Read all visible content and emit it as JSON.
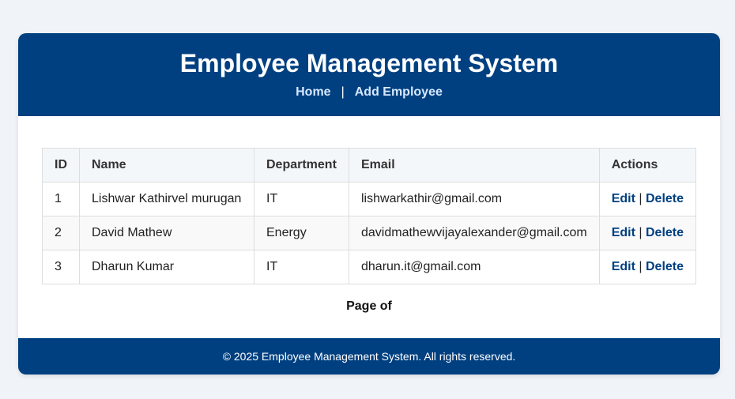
{
  "header": {
    "title": "Employee Management System",
    "nav": {
      "home": "Home",
      "separator": "|",
      "add": "Add Employee"
    }
  },
  "table": {
    "columns": [
      "ID",
      "Name",
      "Department",
      "Email",
      "Actions"
    ],
    "rows": [
      {
        "id": "1",
        "name": "Lishwar Kathirvel murugan",
        "department": "IT",
        "email": "lishwarkathir@gmail.com"
      },
      {
        "id": "2",
        "name": "David Mathew",
        "department": "Energy",
        "email": "davidmathewvijayalexander@gmail.com"
      },
      {
        "id": "3",
        "name": "Dharun Kumar",
        "department": "IT",
        "email": "dharun.it@gmail.com"
      }
    ],
    "actions": {
      "edit": "Edit",
      "separator": "|",
      "delete": "Delete"
    }
  },
  "pagination": {
    "text": "Page of"
  },
  "footer": {
    "text": "© 2025 Employee Management System. All rights reserved."
  },
  "colors": {
    "brand": "#004080",
    "link": "#004080",
    "nav_link": "#d6e8ff",
    "page_bg": "#f0f3f8"
  }
}
